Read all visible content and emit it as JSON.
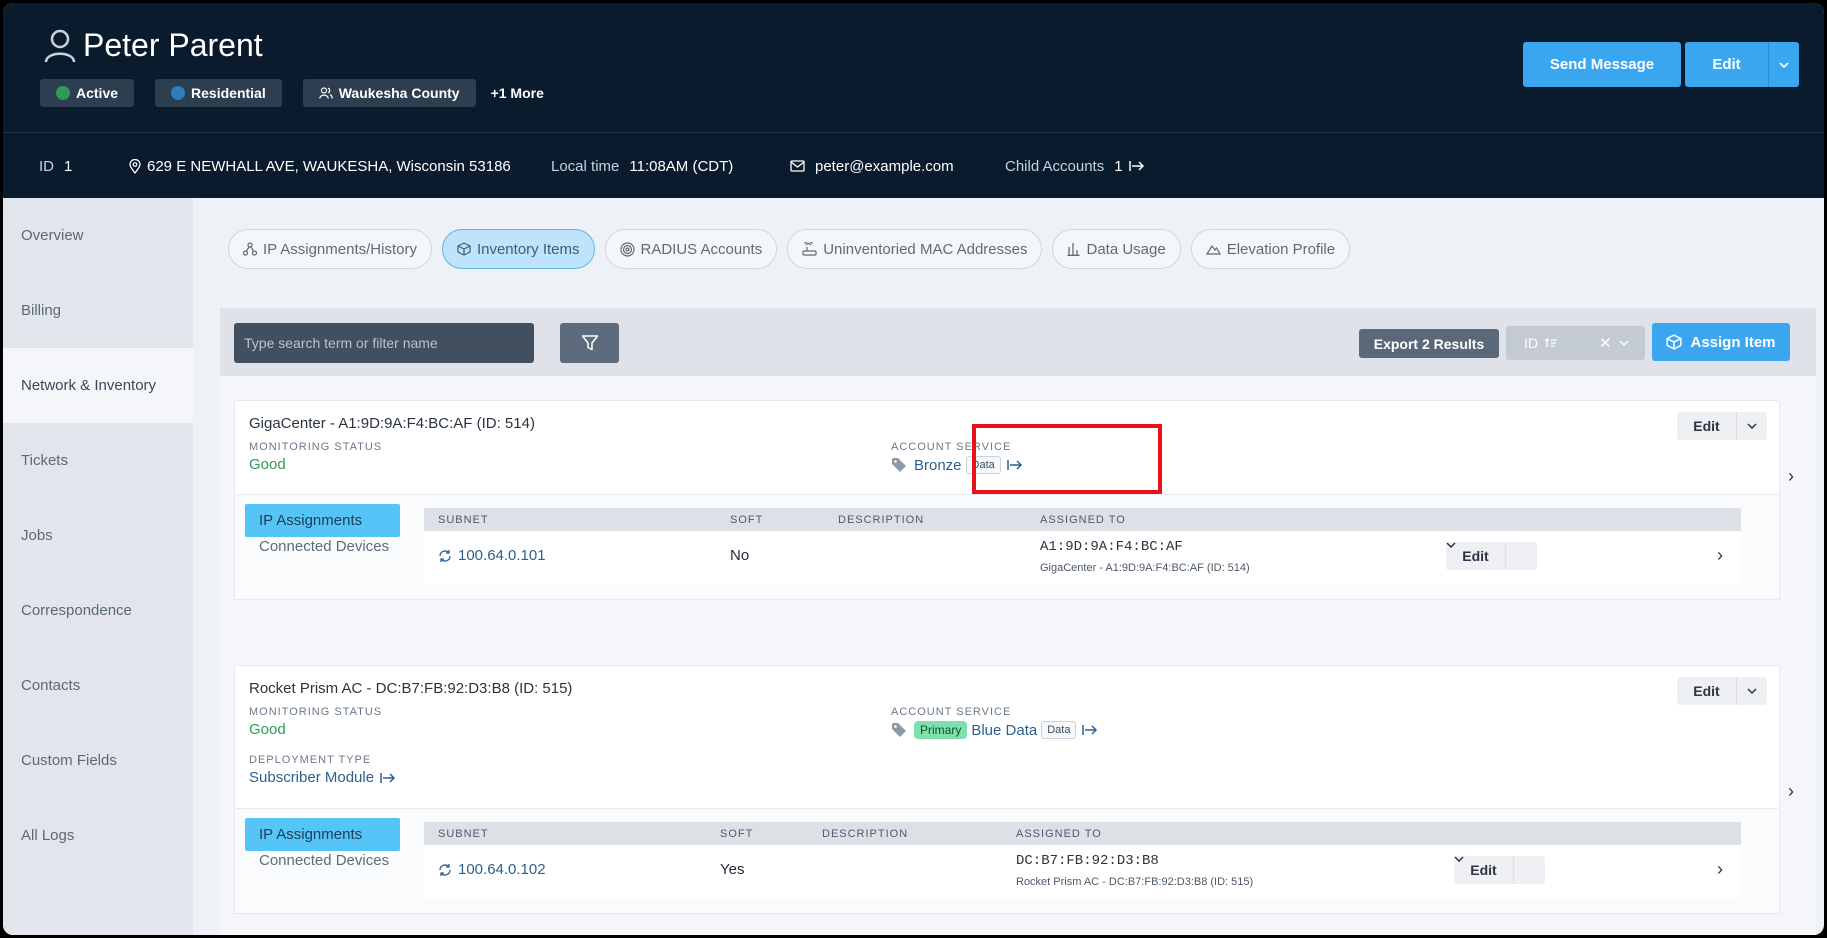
{
  "user": {
    "name": "Peter Parent",
    "chips": [
      {
        "label": "Active",
        "dot_color": "#2f9a55"
      },
      {
        "label": "Residential",
        "dot_color": "#2d7dbf"
      },
      {
        "label": "Waukesha County"
      }
    ],
    "more": "+1 More"
  },
  "actions": {
    "send_message": "Send Message",
    "edit": "Edit"
  },
  "info": {
    "id_label": "ID",
    "id_value": "1",
    "address": "629 E NEWHALL AVE, WAUKESHA, Wisconsin 53186",
    "local_time_label": "Local time",
    "local_time_value": "11:08AM (CDT)",
    "email": "peter@example.com",
    "child_accounts_label": "Child Accounts",
    "child_accounts_value": "1"
  },
  "sidebar": {
    "items": [
      {
        "label": "Overview"
      },
      {
        "label": "Billing"
      },
      {
        "label": "Network & Inventory",
        "active": true
      },
      {
        "label": "Tickets"
      },
      {
        "label": "Jobs"
      },
      {
        "label": "Correspondence"
      },
      {
        "label": "Contacts"
      },
      {
        "label": "Custom Fields"
      },
      {
        "label": "All Logs"
      }
    ]
  },
  "tabs": [
    {
      "label": "IP Assignments/History",
      "icon": "network-icon"
    },
    {
      "label": "Inventory Items",
      "icon": "box-icon",
      "active": true
    },
    {
      "label": "RADIUS Accounts",
      "icon": "target-icon"
    },
    {
      "label": "Uninventoried MAC Addresses",
      "icon": "router-icon"
    },
    {
      "label": "Data Usage",
      "icon": "bar-chart-icon"
    },
    {
      "label": "Elevation Profile",
      "icon": "mountain-icon"
    }
  ],
  "toolbar": {
    "search_placeholder": "Type search term or filter name",
    "export_label": "Export 2 Results",
    "sort_label": "ID",
    "assign_label": "Assign Item"
  },
  "items": [
    {
      "name": "GigaCenter - A1:9D:9A:F4:BC:AF (ID: 514)",
      "monitoring_label": "MONITORING STATUS",
      "monitoring_value": "Good",
      "service_label": "ACCOUNT SERVICE",
      "service_name": "Bronze",
      "service_badge": "Data",
      "edit": "Edit",
      "sub_tab_active": "IP Assignments",
      "sub_tab": "Connected Devices",
      "headers": {
        "subnet": "SUBNET",
        "soft": "SOFT",
        "description": "DESCRIPTION",
        "assigned": "ASSIGNED TO"
      },
      "row": {
        "subnet": "100.64.0.101",
        "soft": "No",
        "assigned_mac": "A1:9D:9A:F4:BC:AF",
        "assigned_desc": "GigaCenter - A1:9D:9A:F4:BC:AF (ID: 514)",
        "edit": "Edit"
      }
    },
    {
      "name": "Rocket Prism AC - DC:B7:FB:92:D3:B8 (ID: 515)",
      "monitoring_label": "MONITORING STATUS",
      "monitoring_value": "Good",
      "deployment_label": "DEPLOYMENT TYPE",
      "deployment_value": "Subscriber Module",
      "service_label": "ACCOUNT SERVICE",
      "service_primary": "Primary",
      "service_name": "Blue Data",
      "service_badge": "Data",
      "edit": "Edit",
      "sub_tab_active": "IP Assignments",
      "sub_tab": "Connected Devices",
      "headers": {
        "subnet": "SUBNET",
        "soft": "SOFT",
        "description": "DESCRIPTION",
        "assigned": "ASSIGNED TO"
      },
      "row": {
        "subnet": "100.64.0.102",
        "soft": "Yes",
        "assigned_mac": "DC:B7:FB:92:D3:B8",
        "assigned_desc": "Rocket Prism AC - DC:B7:FB:92:D3:B8 (ID: 515)",
        "edit": "Edit"
      }
    }
  ]
}
